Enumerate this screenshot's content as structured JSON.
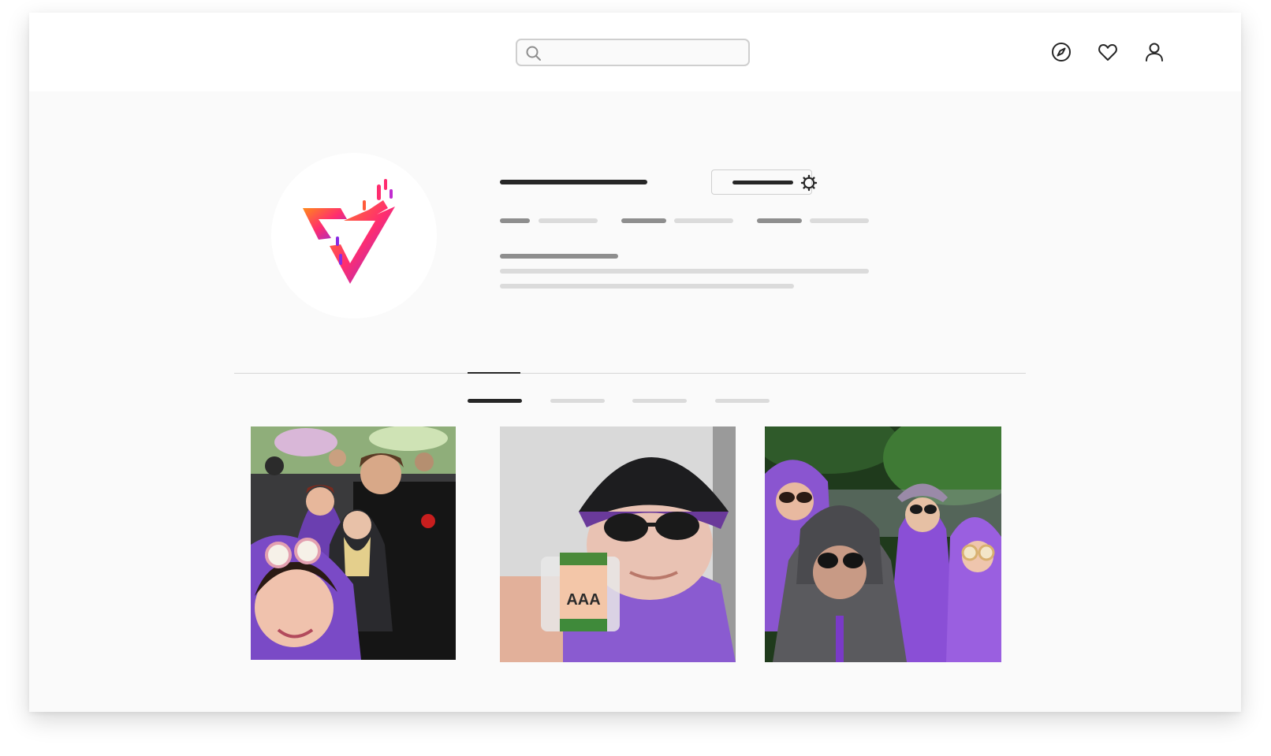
{
  "search": {
    "placeholder": ""
  },
  "header": {
    "icons": [
      "compass-icon",
      "heart-icon",
      "user-icon"
    ]
  },
  "profile": {
    "avatar_icon": "festival-logo",
    "settings_icon": "gear-icon"
  },
  "posts": [
    {
      "icon": "photo-group-selfie"
    },
    {
      "icon": "photo-wristband-selfie",
      "badge_text": "AAA"
    },
    {
      "icon": "photo-rain-ponchos"
    }
  ],
  "colors": {
    "window_bg": "#fafafa",
    "topbar_bg": "#ffffff",
    "skeleton_dark": "#262626",
    "skeleton_mid": "#8e8e8e",
    "skeleton_light": "#dbdbdb",
    "poncho_purple": "#8a4ad0",
    "logo_orange": "#ff7a1a",
    "logo_purple": "#8a2be2"
  }
}
